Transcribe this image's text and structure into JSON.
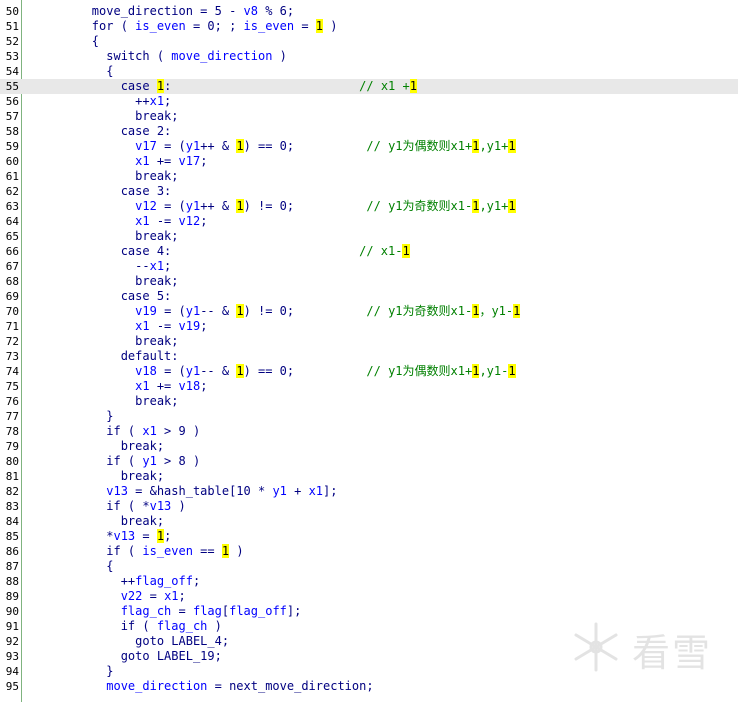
{
  "editor": {
    "colors": {
      "background": "#ffffff",
      "keyword": "#000080",
      "variable": "#0000ff",
      "comment": "#008000",
      "number_highlight": "#ffff00",
      "current_line": "#e8e8e8",
      "gutter_line": "#7fb37f"
    },
    "current_line_number": "55",
    "lines": [
      {
        "num": "50",
        "segs": [
          [
            "k",
            "        move_direction = 5 - "
          ],
          [
            "v",
            "v8"
          ],
          [
            "k",
            " % 6;"
          ]
        ]
      },
      {
        "num": "51",
        "segs": [
          [
            "k",
            "        for ( "
          ],
          [
            "v",
            "is_even"
          ],
          [
            "k",
            " = 0; ; "
          ],
          [
            "v",
            "is_even"
          ],
          [
            "k",
            " = "
          ],
          [
            "n",
            "1"
          ],
          [
            "k",
            " )"
          ]
        ]
      },
      {
        "num": "52",
        "segs": [
          [
            "k",
            "        {"
          ]
        ]
      },
      {
        "num": "53",
        "segs": [
          [
            "k",
            "          switch ( "
          ],
          [
            "v",
            "move_direction"
          ],
          [
            "k",
            " )"
          ]
        ]
      },
      {
        "num": "54",
        "segs": [
          [
            "k",
            "          {"
          ]
        ]
      },
      {
        "num": "55",
        "segs": [
          [
            "k",
            "            case "
          ],
          [
            "n",
            "1"
          ],
          [
            "k",
            ":"
          ],
          [
            "s",
            "                          "
          ],
          [
            "c",
            "// x1 +"
          ],
          [
            "n",
            "1"
          ]
        ]
      },
      {
        "num": "56",
        "segs": [
          [
            "k",
            "              ++"
          ],
          [
            "v",
            "x1"
          ],
          [
            "k",
            ";"
          ]
        ]
      },
      {
        "num": "57",
        "segs": [
          [
            "k",
            "              break;"
          ]
        ]
      },
      {
        "num": "58",
        "segs": [
          [
            "k",
            "            case 2:"
          ]
        ]
      },
      {
        "num": "59",
        "segs": [
          [
            "k",
            "              "
          ],
          [
            "v",
            "v17"
          ],
          [
            "k",
            " = ("
          ],
          [
            "v",
            "y1"
          ],
          [
            "k",
            "++ & "
          ],
          [
            "n",
            "1"
          ],
          [
            "k",
            ") == 0;"
          ],
          [
            "s",
            "          "
          ],
          [
            "c",
            "// y1为偶数则x1+"
          ],
          [
            "n",
            "1"
          ],
          [
            "c",
            ",y1+"
          ],
          [
            "n",
            "1"
          ]
        ]
      },
      {
        "num": "60",
        "segs": [
          [
            "k",
            "              "
          ],
          [
            "v",
            "x1"
          ],
          [
            "k",
            " += "
          ],
          [
            "v",
            "v17"
          ],
          [
            "k",
            ";"
          ]
        ]
      },
      {
        "num": "61",
        "segs": [
          [
            "k",
            "              break;"
          ]
        ]
      },
      {
        "num": "62",
        "segs": [
          [
            "k",
            "            case 3:"
          ]
        ]
      },
      {
        "num": "63",
        "segs": [
          [
            "k",
            "              "
          ],
          [
            "v",
            "v12"
          ],
          [
            "k",
            " = ("
          ],
          [
            "v",
            "y1"
          ],
          [
            "k",
            "++ & "
          ],
          [
            "n",
            "1"
          ],
          [
            "k",
            ") != 0;"
          ],
          [
            "s",
            "          "
          ],
          [
            "c",
            "// y1为奇数则x1-"
          ],
          [
            "n",
            "1"
          ],
          [
            "c",
            ",y1+"
          ],
          [
            "n",
            "1"
          ]
        ]
      },
      {
        "num": "64",
        "segs": [
          [
            "k",
            "              "
          ],
          [
            "v",
            "x1"
          ],
          [
            "k",
            " -= "
          ],
          [
            "v",
            "v12"
          ],
          [
            "k",
            ";"
          ]
        ]
      },
      {
        "num": "65",
        "segs": [
          [
            "k",
            "              break;"
          ]
        ]
      },
      {
        "num": "66",
        "segs": [
          [
            "k",
            "            case 4:"
          ],
          [
            "s",
            "                          "
          ],
          [
            "c",
            "// x1-"
          ],
          [
            "n",
            "1"
          ]
        ]
      },
      {
        "num": "67",
        "segs": [
          [
            "k",
            "              --"
          ],
          [
            "v",
            "x1"
          ],
          [
            "k",
            ";"
          ]
        ]
      },
      {
        "num": "68",
        "segs": [
          [
            "k",
            "              break;"
          ]
        ]
      },
      {
        "num": "69",
        "segs": [
          [
            "k",
            "            case 5:"
          ]
        ]
      },
      {
        "num": "70",
        "segs": [
          [
            "k",
            "              "
          ],
          [
            "v",
            "v19"
          ],
          [
            "k",
            " = ("
          ],
          [
            "v",
            "y1"
          ],
          [
            "k",
            "-- & "
          ],
          [
            "n",
            "1"
          ],
          [
            "k",
            ") != 0;"
          ],
          [
            "s",
            "          "
          ],
          [
            "c",
            "// y1为奇数则x1-"
          ],
          [
            "n",
            "1"
          ],
          [
            "c",
            "，y1-"
          ],
          [
            "n",
            "1"
          ]
        ]
      },
      {
        "num": "71",
        "segs": [
          [
            "k",
            "              "
          ],
          [
            "v",
            "x1"
          ],
          [
            "k",
            " -= "
          ],
          [
            "v",
            "v19"
          ],
          [
            "k",
            ";"
          ]
        ]
      },
      {
        "num": "72",
        "segs": [
          [
            "k",
            "              break;"
          ]
        ]
      },
      {
        "num": "73",
        "segs": [
          [
            "k",
            "            default:"
          ]
        ]
      },
      {
        "num": "74",
        "segs": [
          [
            "k",
            "              "
          ],
          [
            "v",
            "v18"
          ],
          [
            "k",
            " = ("
          ],
          [
            "v",
            "y1"
          ],
          [
            "k",
            "-- & "
          ],
          [
            "n",
            "1"
          ],
          [
            "k",
            ") == 0;"
          ],
          [
            "s",
            "          "
          ],
          [
            "c",
            "// y1为偶数则x1+"
          ],
          [
            "n",
            "1"
          ],
          [
            "c",
            ",y1-"
          ],
          [
            "n",
            "1"
          ]
        ]
      },
      {
        "num": "75",
        "segs": [
          [
            "k",
            "              "
          ],
          [
            "v",
            "x1"
          ],
          [
            "k",
            " += "
          ],
          [
            "v",
            "v18"
          ],
          [
            "k",
            ";"
          ]
        ]
      },
      {
        "num": "76",
        "segs": [
          [
            "k",
            "              break;"
          ]
        ]
      },
      {
        "num": "77",
        "segs": [
          [
            "k",
            "          }"
          ]
        ]
      },
      {
        "num": "78",
        "segs": [
          [
            "k",
            "          if ( "
          ],
          [
            "v",
            "x1"
          ],
          [
            "k",
            " > 9 )"
          ]
        ]
      },
      {
        "num": "79",
        "segs": [
          [
            "k",
            "            break;"
          ]
        ]
      },
      {
        "num": "80",
        "segs": [
          [
            "k",
            "          if ( "
          ],
          [
            "v",
            "y1"
          ],
          [
            "k",
            " > 8 )"
          ]
        ]
      },
      {
        "num": "81",
        "segs": [
          [
            "k",
            "            break;"
          ]
        ]
      },
      {
        "num": "82",
        "segs": [
          [
            "k",
            "          "
          ],
          [
            "v",
            "v13"
          ],
          [
            "k",
            " = &hash_table[10 * "
          ],
          [
            "v",
            "y1"
          ],
          [
            "k",
            " + "
          ],
          [
            "v",
            "x1"
          ],
          [
            "k",
            "];"
          ]
        ]
      },
      {
        "num": "83",
        "segs": [
          [
            "k",
            "          if ( *"
          ],
          [
            "v",
            "v13"
          ],
          [
            "k",
            " )"
          ]
        ]
      },
      {
        "num": "84",
        "segs": [
          [
            "k",
            "            break;"
          ]
        ]
      },
      {
        "num": "85",
        "segs": [
          [
            "k",
            "          *"
          ],
          [
            "v",
            "v13"
          ],
          [
            "k",
            " = "
          ],
          [
            "n",
            "1"
          ],
          [
            "k",
            ";"
          ]
        ]
      },
      {
        "num": "86",
        "segs": [
          [
            "k",
            "          if ( "
          ],
          [
            "v",
            "is_even"
          ],
          [
            "k",
            " == "
          ],
          [
            "n",
            "1"
          ],
          [
            "k",
            " )"
          ]
        ]
      },
      {
        "num": "87",
        "segs": [
          [
            "k",
            "          {"
          ]
        ]
      },
      {
        "num": "88",
        "segs": [
          [
            "k",
            "            ++"
          ],
          [
            "v",
            "flag_off"
          ],
          [
            "k",
            ";"
          ]
        ]
      },
      {
        "num": "89",
        "segs": [
          [
            "k",
            "            "
          ],
          [
            "v",
            "v22"
          ],
          [
            "k",
            " = "
          ],
          [
            "v",
            "x1"
          ],
          [
            "k",
            ";"
          ]
        ]
      },
      {
        "num": "90",
        "segs": [
          [
            "k",
            "            "
          ],
          [
            "v",
            "flag_ch"
          ],
          [
            "k",
            " = "
          ],
          [
            "v",
            "flag"
          ],
          [
            "k",
            "["
          ],
          [
            "v",
            "flag_off"
          ],
          [
            "k",
            "];"
          ]
        ]
      },
      {
        "num": "91",
        "segs": [
          [
            "k",
            "            if ( "
          ],
          [
            "v",
            "flag_ch"
          ],
          [
            "k",
            " )"
          ]
        ]
      },
      {
        "num": "92",
        "segs": [
          [
            "k",
            "              goto LABEL_4;"
          ]
        ]
      },
      {
        "num": "93",
        "segs": [
          [
            "k",
            "            goto LABEL_19;"
          ]
        ]
      },
      {
        "num": "94",
        "segs": [
          [
            "k",
            "          }"
          ]
        ]
      },
      {
        "num": "95",
        "segs": [
          [
            "k",
            "          "
          ],
          [
            "v",
            "move_direction"
          ],
          [
            "k",
            " = next_move_direction;"
          ]
        ]
      }
    ]
  },
  "watermark": {
    "text": "看雪",
    "icon": "snowflake-icon"
  }
}
